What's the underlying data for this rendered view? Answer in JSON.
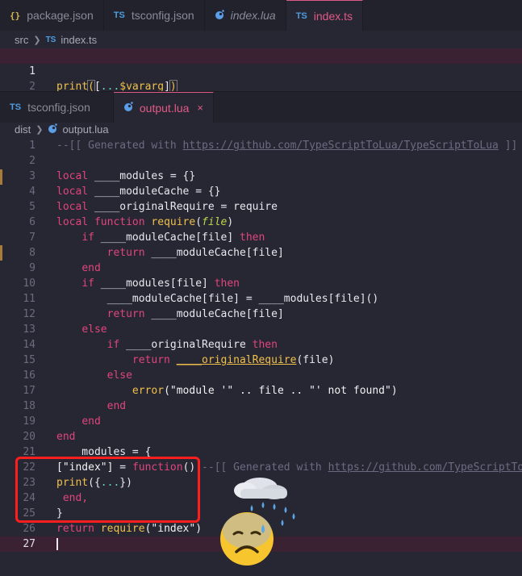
{
  "top_tabs": [
    {
      "icon": "{}",
      "label": "package.json"
    },
    {
      "icon": "TS",
      "label": "tsconfig.json"
    },
    {
      "icon": "lua",
      "label": "index.lua"
    },
    {
      "icon": "TS",
      "label": "index.ts"
    }
  ],
  "top_crumbs": {
    "folder": "src",
    "icon": "TS",
    "file": "index.ts"
  },
  "top_lines": {
    "n1": "1",
    "n2": "2",
    "print_fn": "print",
    "open": "(",
    "bracket_open": "[",
    "spread": "...",
    "vararg": "$vararg",
    "bracket_close": "]",
    "close": ")"
  },
  "bottom_tabs": [
    {
      "icon": "TS",
      "label": "tsconfig.json"
    },
    {
      "icon": "lua",
      "label": "output.lua",
      "close": "×"
    }
  ],
  "bottom_crumbs": {
    "folder": "dist",
    "file": "output.lua"
  },
  "lua": {
    "ln": [
      "1",
      "2",
      "3",
      "4",
      "5",
      "6",
      "7",
      "8",
      "9",
      "10",
      "11",
      "12",
      "13",
      "14",
      "15",
      "16",
      "17",
      "18",
      "19",
      "20",
      "21",
      "22",
      "23",
      "24",
      "25",
      "26",
      "27"
    ],
    "l1_a": "--[[ Generated with ",
    "l1_url": "https://github.com/TypeScriptToLua/TypeScriptToLua",
    "l1_b": " ]]",
    "local": "local",
    "function": "function",
    "if": "if",
    "then": "then",
    "return": "return",
    "end": "end",
    "else": "else",
    "require": "require",
    "error": "error",
    "file": "file",
    "mods": "____modules",
    "modCache": "____moduleCache",
    "origReq": "____originalRequire",
    "l3_rest": " = {}",
    "l4_rest": " = {}",
    "l5_eq": " = ",
    "l6_open": "(",
    "l6_close": ")",
    "bracket_file": "[file]",
    "l11_eq": " = ",
    "l11_call": "[file]()",
    "paren_file": "(file)",
    "l17_args": "(\"module '\" .. file .. \"' not found\")",
    "l21_rest": " = {",
    "l22_key": "[\"index\"]",
    "l22_eq": " = ",
    "l22_fn": "function",
    "l22_paren": "()",
    "l22_cm": " --[[ Generated with ",
    "l22_url": "https://github.com/TypeScriptToLua",
    "l23_print": "print",
    "l23_open": "({",
    "l23_dots": "...",
    "l23_close": "})",
    "l24": " end,",
    "l25": "}",
    "l26_arg": "(\"index\")"
  }
}
